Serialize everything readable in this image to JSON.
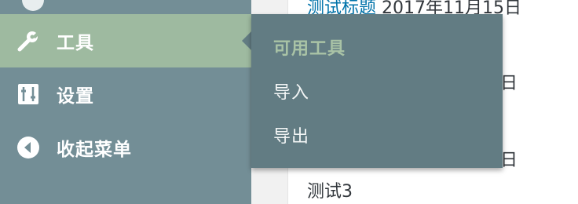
{
  "sidebar": {
    "items": [
      {
        "label": "工具",
        "icon": "wrench-icon",
        "active": true
      },
      {
        "label": "设置",
        "icon": "sliders-icon"
      },
      {
        "label": "收起菜单",
        "icon": "collapse-arrow-icon"
      }
    ]
  },
  "flyout": {
    "title": "可用工具",
    "items": [
      {
        "label": "导入"
      },
      {
        "label": "导出"
      }
    ]
  },
  "posts": {
    "row1_link": "测试标题",
    "row1_date": "2017年11月15日",
    "row2_frag": "日",
    "row3_frag": "日",
    "row4_title": "测试3"
  },
  "colors": {
    "sidebar_bg": "#738e96",
    "active_bg": "#9ebaa0",
    "flyout_bg": "#627c83",
    "flyout_title": "#a9c3a6",
    "link": "#0073aa"
  }
}
